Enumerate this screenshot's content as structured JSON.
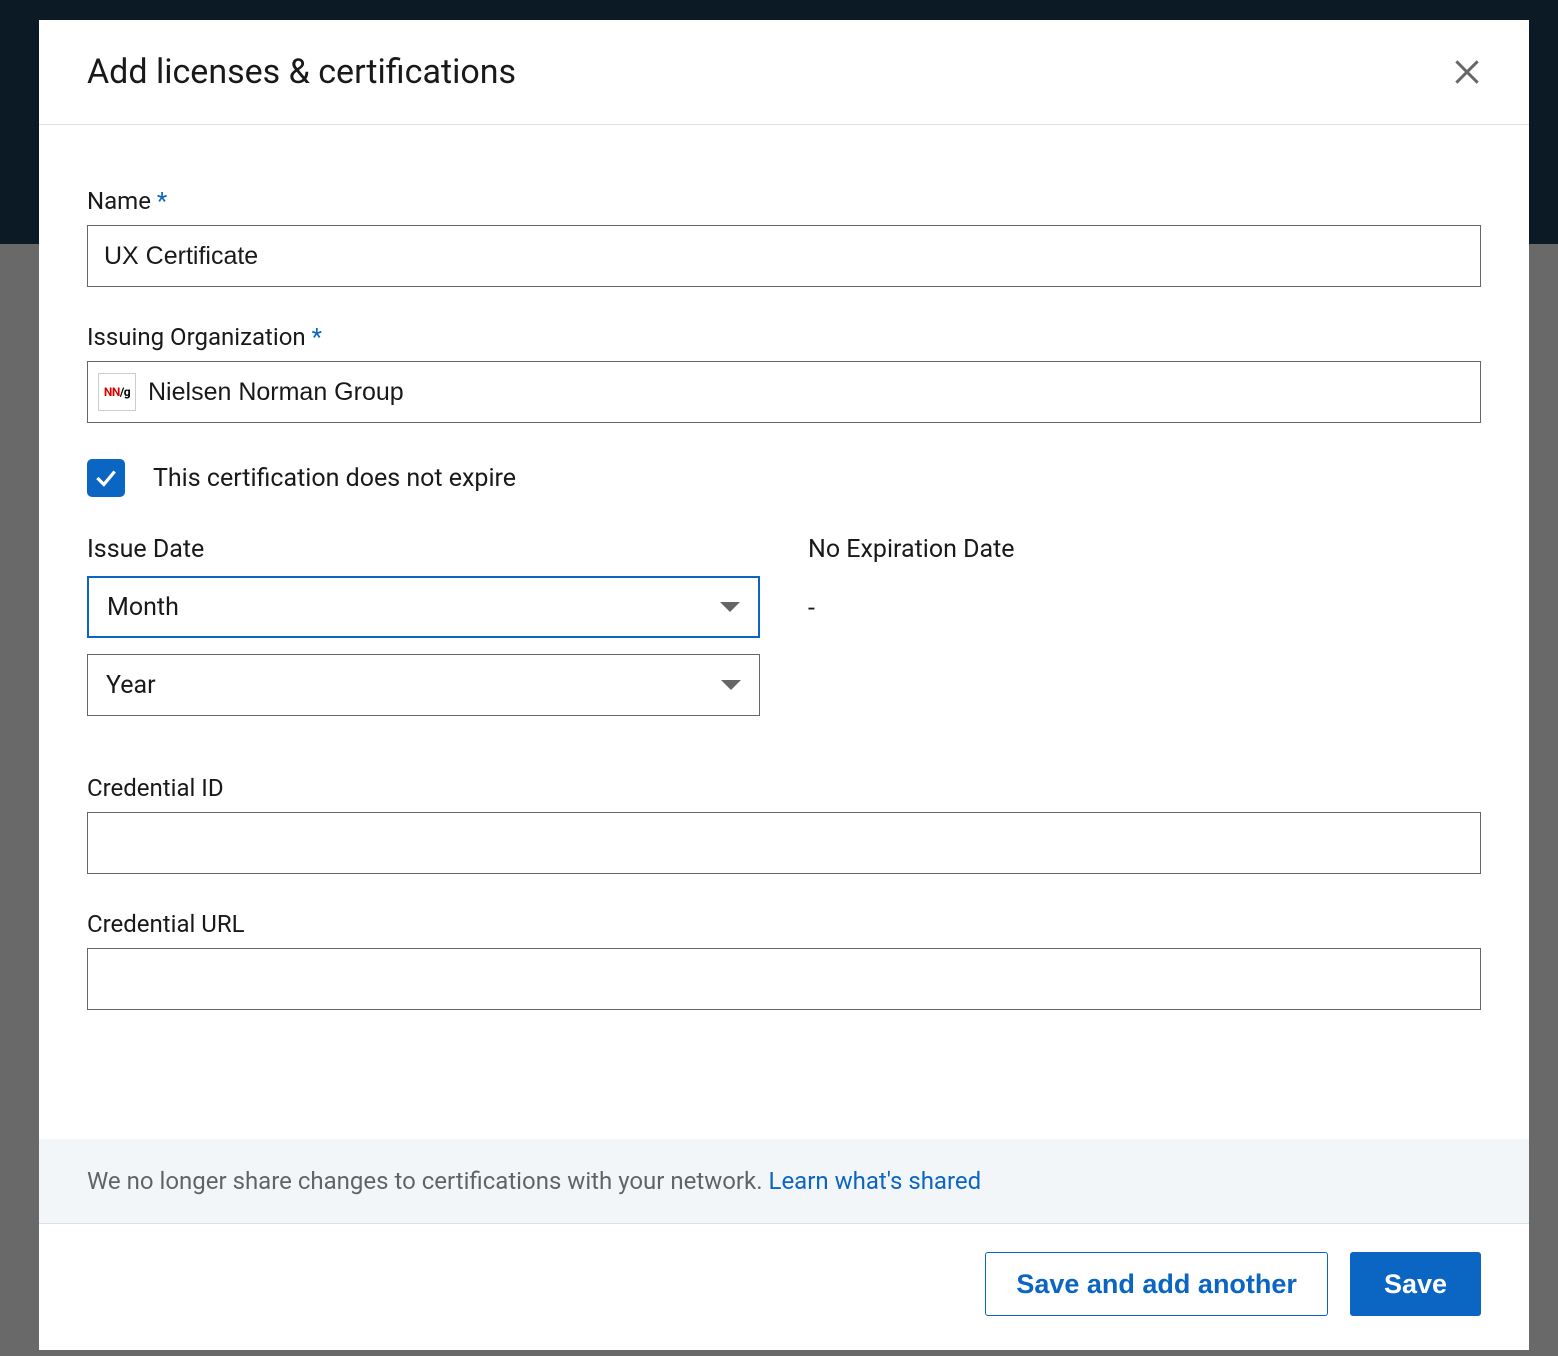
{
  "modal": {
    "title": "Add licenses & certifications"
  },
  "fields": {
    "name": {
      "label": "Name",
      "required": "*",
      "value": "UX Certificate"
    },
    "org": {
      "label": "Issuing Organization",
      "required": "*",
      "logo_text": "NN/g",
      "value": "Nielsen Norman Group"
    },
    "no_expire": {
      "label": "This certification does not expire",
      "checked": true
    },
    "issue_date": {
      "label": "Issue Date",
      "month_placeholder": "Month",
      "year_placeholder": "Year"
    },
    "expiry": {
      "label": "No Expiration Date",
      "value": "-"
    },
    "credential_id": {
      "label": "Credential ID",
      "value": ""
    },
    "credential_url": {
      "label": "Credential URL",
      "value": ""
    }
  },
  "banner": {
    "text": "We no longer share changes to certifications with your network. ",
    "link": "Learn what's shared"
  },
  "footer": {
    "save_another": "Save and add another",
    "save": "Save"
  }
}
